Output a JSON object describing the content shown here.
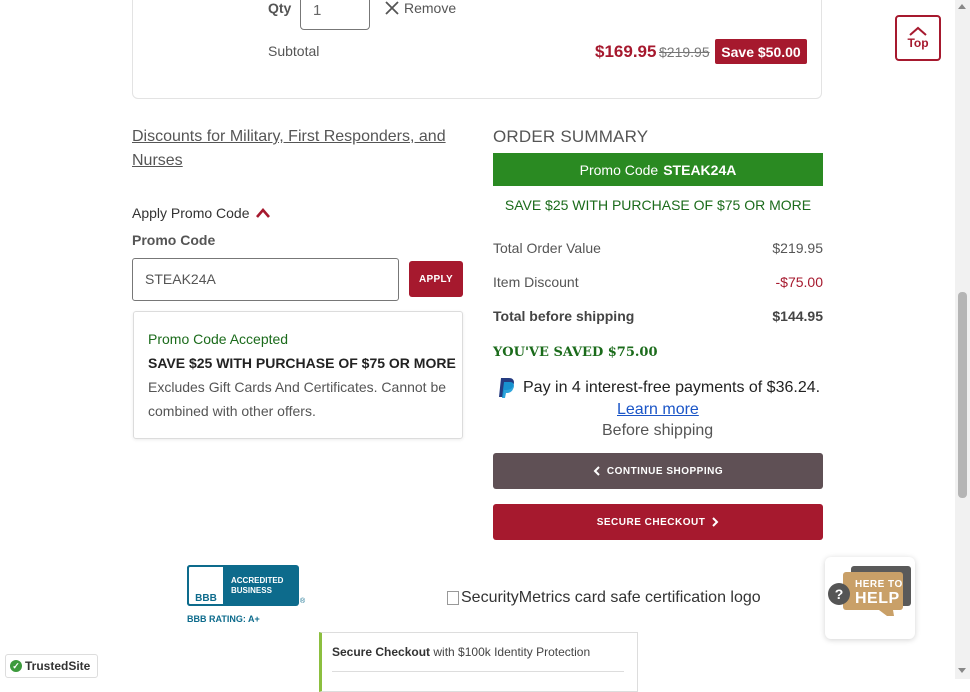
{
  "cart_item": {
    "qty_label": "Qty",
    "qty_value": "1",
    "remove_label": "Remove",
    "subtotal_label": "Subtotal",
    "price_now": "$169.95",
    "price_was": "$219.95",
    "save_badge": "Save $50.00"
  },
  "discounts": {
    "link_text": "Discounts for Military, First Responders, and Nurses",
    "apply_toggle_label": "Apply Promo Code",
    "promo_label": "Promo Code",
    "promo_value": "STEAK24A",
    "apply_button": "APPLY",
    "accepted_title": "Promo Code Accepted",
    "accepted_headline": "SAVE $25 WITH PURCHASE OF $75 OR MORE",
    "accepted_desc": "Excludes Gift Cards And Certificates. Cannot be combined with other offers."
  },
  "summary": {
    "title": "ORDER SUMMARY",
    "promo_bar_label": "Promo Code",
    "promo_bar_code": "STEAK24A",
    "promo_message": "SAVE $25 WITH PURCHASE OF $75 OR MORE",
    "rows": [
      {
        "label": "Total Order Value",
        "value": "$219.95"
      },
      {
        "label": "Item Discount",
        "value": "-$75.00"
      },
      {
        "label": "Total before shipping",
        "value": "$144.95"
      }
    ],
    "saved_text": "YOU'VE SAVED $75.00",
    "paypal_text": "Pay in 4 interest-free payments of $36.24.",
    "learn_more": "Learn more",
    "before_shipping": "Before shipping",
    "continue_button": "CONTINUE SHOPPING",
    "checkout_button": "SECURE CHECKOUT"
  },
  "footer": {
    "bbb_line1": "ACCREDITED",
    "bbb_line2": "BUSINESS",
    "bbb_logo": "BBB",
    "bbb_registered": "®",
    "bbb_rating": "BBB RATING: A+",
    "securitymetrics_alt": "SecurityMetrics card safe certification logo",
    "secure_checkout_bold": "Secure Checkout",
    "secure_checkout_rest": " with $100k Identity Protection",
    "trustedsite_label": "TrustedSite",
    "trustedsite_check": "✓"
  },
  "widgets": {
    "top_label": "Top",
    "help_small": "HERE TO",
    "help_big": "HELP",
    "help_question": "?"
  },
  "colors": {
    "brand_red": "#a6192e",
    "promo_green": "#2a8a22",
    "text_green": "#1b6b1b",
    "continue_gray": "#5f5055",
    "bbb_blue": "#0d6b8c"
  },
  "icons": [
    "close-icon",
    "chevron-up-icon",
    "chevron-left-icon",
    "chevron-right-icon",
    "paypal-icon",
    "arrow-up-icon"
  ]
}
